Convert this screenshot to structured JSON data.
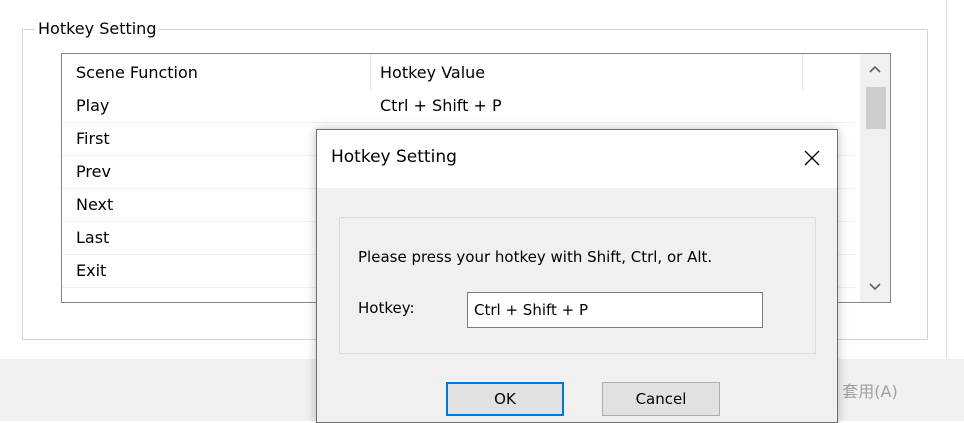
{
  "group": {
    "title": "Hotkey Setting"
  },
  "list": {
    "headers": [
      "Scene Function",
      "Hotkey Value"
    ],
    "rows": [
      {
        "function": "Play",
        "value": "Ctrl + Shift + P"
      },
      {
        "function": "First",
        "value": ""
      },
      {
        "function": "Prev",
        "value": ""
      },
      {
        "function": "Next",
        "value": ""
      },
      {
        "function": "Last",
        "value": ""
      },
      {
        "function": "Exit",
        "value": ""
      }
    ]
  },
  "bottom": {
    "apply_label": "套用(A)"
  },
  "dialog": {
    "title": "Hotkey Setting",
    "close_icon": "close-icon",
    "instruction": "Please press your hotkey with Shift, Ctrl, or Alt.",
    "hotkey_label": "Hotkey:",
    "hotkey_value": "Ctrl + Shift + P",
    "ok_label": "OK",
    "cancel_label": "Cancel"
  },
  "colors": {
    "accent": "#0078d7",
    "disabled_text": "#a0a0a0"
  }
}
